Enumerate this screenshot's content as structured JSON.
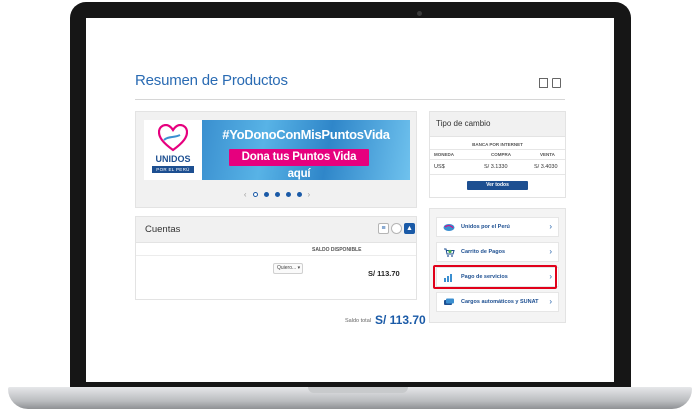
{
  "page": {
    "title": "Resumen de Productos"
  },
  "banner": {
    "logo_main": "UNIDOS",
    "logo_sub": "POR EL PERÚ",
    "hashtag": "#YoDonoConMisPuntosVida",
    "cta": "Dona tus Puntos Vida aquí",
    "prev_arrow": "‹",
    "next_arrow": "›",
    "slide_count": 5,
    "active_slide": 1
  },
  "cuentas": {
    "title": "Cuentas",
    "column_header": "SALDO DISPONIBLE",
    "action_select": "Quiero...",
    "amount": "S/ 113.70",
    "total_label": "Saldo total",
    "total_amount": "S/ 113.70"
  },
  "tipo_cambio": {
    "title": "Tipo de cambio",
    "subtitle": "BANCA POR INTERNET",
    "columns": [
      "MONEDA",
      "COMPRA",
      "VENTA"
    ],
    "row": {
      "currency": "US$",
      "compra": "S/ 3.1330",
      "venta": "S/ 3.4030"
    },
    "button": "Ver todos"
  },
  "links": [
    {
      "label": "Unidos por el Perú",
      "icon": "unidos-logo-icon"
    },
    {
      "label": "Carrito de Pagos",
      "icon": "cart-icon"
    },
    {
      "label": "Pago de servicios",
      "icon": "bar-chart-icon",
      "highlighted": true
    },
    {
      "label": "Cargos automáticos y SUNAT",
      "icon": "cards-icon"
    }
  ],
  "colors": {
    "brand_blue": "#1d4f91",
    "link_blue": "#2a6bb3",
    "magenta": "#e6007e",
    "highlight_red": "#e1001a"
  }
}
